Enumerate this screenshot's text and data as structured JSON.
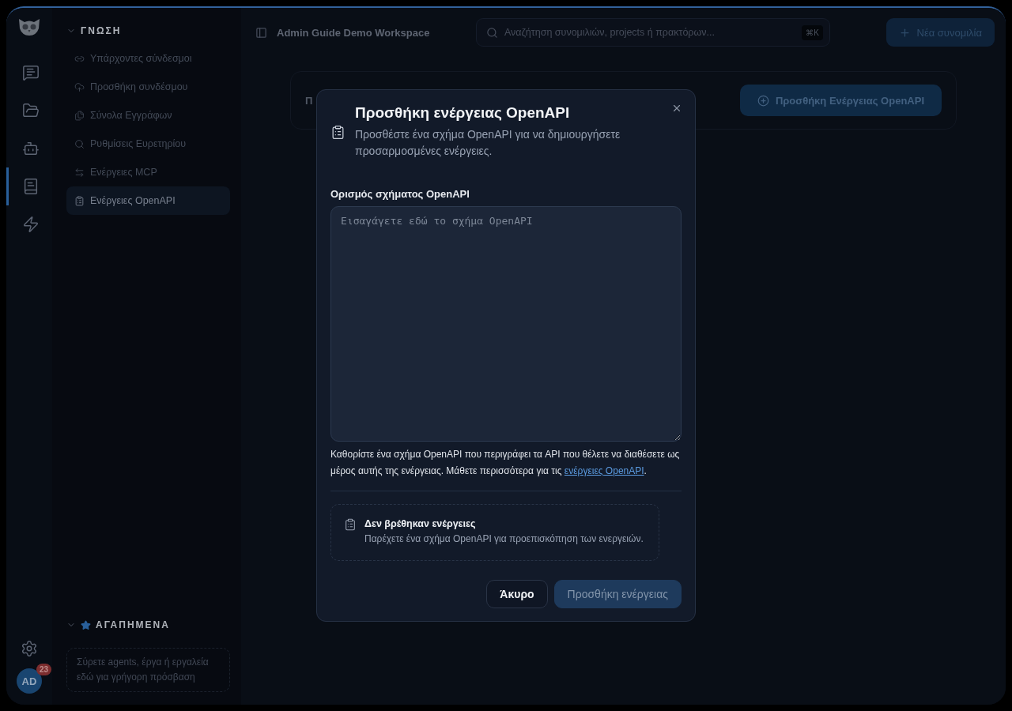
{
  "rail": {
    "items": [
      {
        "selected": false
      },
      {
        "selected": false
      },
      {
        "selected": false
      },
      {
        "selected": true
      },
      {
        "selected": false
      }
    ],
    "avatar": "AD",
    "badge": "23"
  },
  "sidebar": {
    "section": {
      "title": "ΓΝΩΣΗ",
      "expanded": true,
      "items": [
        {
          "label": "Υπάρχοντες σύνδεσμοι",
          "selected": false
        },
        {
          "label": "Προσθήκη συνδέσμου",
          "selected": false
        },
        {
          "label": "Σύνολα Εγγράφων",
          "selected": false
        },
        {
          "label": "Ρυθμίσεις Ευρετηρίου",
          "selected": false
        },
        {
          "label": "Ενέργειες MCP",
          "selected": false
        },
        {
          "label": "Ενέργειες OpenAPI",
          "selected": true
        }
      ]
    },
    "favorites": {
      "title": "ΑΓΑΠΗΜΕΝΑ",
      "expanded": true,
      "hint": "Σύρετε agents, έργα ή εργαλεία εδώ για γρήγορη πρόσβαση"
    }
  },
  "topbar": {
    "workspace": "Admin Guide Demo Workspace",
    "search_placeholder": "Αναζήτηση συνομιλιών, projects ή πρακτόρων...",
    "shortcut": "⌘K",
    "new_button": "Νέα συνομιλία"
  },
  "card": {
    "title": "Π",
    "button": "Προσθήκη Ενέργειας OpenAPI"
  },
  "dialog": {
    "title": "Προσθήκη ενέργειας OpenAPI",
    "description": "Προσθέστε ένα σχήμα OpenAPI για να δημιουργήσετε προσαρμοσμένες ενέργειες.",
    "field_label": "Ορισμός σχήματος OpenAPI",
    "placeholder": "Εισαγάγετε εδώ το σχήμα OpenAPI",
    "help": {
      "text": "Καθορίστε ένα σχήμα OpenAPI που περιγράφει τα API που θέλετε να διαθέσετε ως μέρος αυτής της ενέργειας. Μάθετε περισσότερα για τις",
      "link": "ενέργειες OpenAPI",
      "end": "."
    },
    "empty": {
      "title": "Δεν βρέθηκαν ενέργειες",
      "text": "Παρέχετε ένα σχήμα OpenAPI για προεπισκόπηση των ενεργειών."
    },
    "buttons": [
      {
        "label": "Άκυρο",
        "kind": "secondary",
        "disabled": false
      },
      {
        "label": "Προσθήκη ενέργειας",
        "kind": "primary",
        "disabled": true
      }
    ]
  }
}
